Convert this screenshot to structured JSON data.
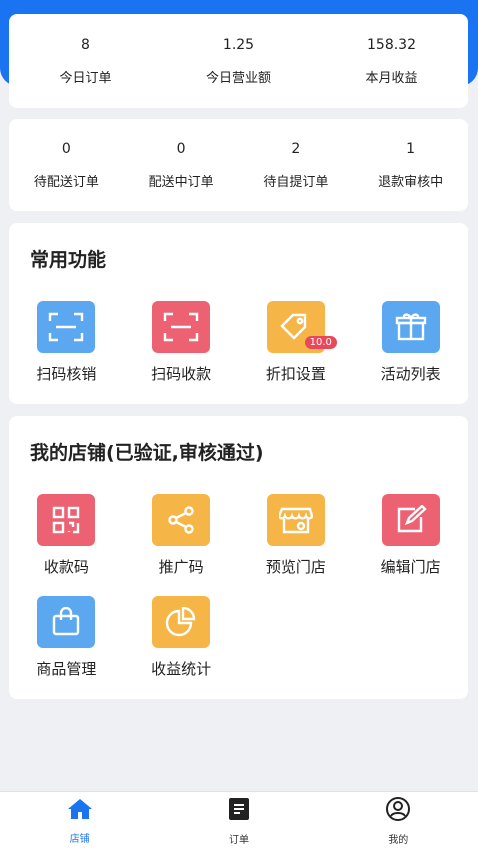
{
  "summary": [
    {
      "value": "8",
      "label": "今日订单"
    },
    {
      "value": "1.25",
      "label": "今日营业额"
    },
    {
      "value": "158.32",
      "label": "本月收益"
    }
  ],
  "orders": [
    {
      "value": "0",
      "label": "待配送订单"
    },
    {
      "value": "0",
      "label": "配送中订单"
    },
    {
      "value": "2",
      "label": "待自提订单"
    },
    {
      "value": "1",
      "label": "退款审核中"
    }
  ],
  "common": {
    "title": "常用功能",
    "items": [
      {
        "label": "扫码核销",
        "icon": "scan-icon",
        "color": "#5ba7f0"
      },
      {
        "label": "扫码收款",
        "icon": "scan-icon",
        "color": "#ec6272"
      },
      {
        "label": "折扣设置",
        "icon": "tag-icon",
        "color": "#f5b647",
        "badge": "10.0"
      },
      {
        "label": "活动列表",
        "icon": "gift-icon",
        "color": "#5ba7f0"
      }
    ]
  },
  "store": {
    "title": "我的店铺(已验证,审核通过)",
    "items": [
      {
        "label": "收款码",
        "icon": "qrcode-icon",
        "color": "#ec6272"
      },
      {
        "label": "推广码",
        "icon": "share-icon",
        "color": "#f5b647"
      },
      {
        "label": "预览门店",
        "icon": "storefront-icon",
        "color": "#f5b647"
      },
      {
        "label": "编辑门店",
        "icon": "edit-icon",
        "color": "#ec6272"
      },
      {
        "label": "商品管理",
        "icon": "shopping-bag-icon",
        "color": "#5ba7f0"
      },
      {
        "label": "收益统计",
        "icon": "pie-chart-icon",
        "color": "#f5b647"
      }
    ]
  },
  "tabbar": [
    {
      "label": "店铺",
      "icon": "home-icon",
      "active": true
    },
    {
      "label": "订单",
      "icon": "document-icon",
      "active": false
    },
    {
      "label": "我的",
      "icon": "user-icon",
      "active": false
    }
  ]
}
